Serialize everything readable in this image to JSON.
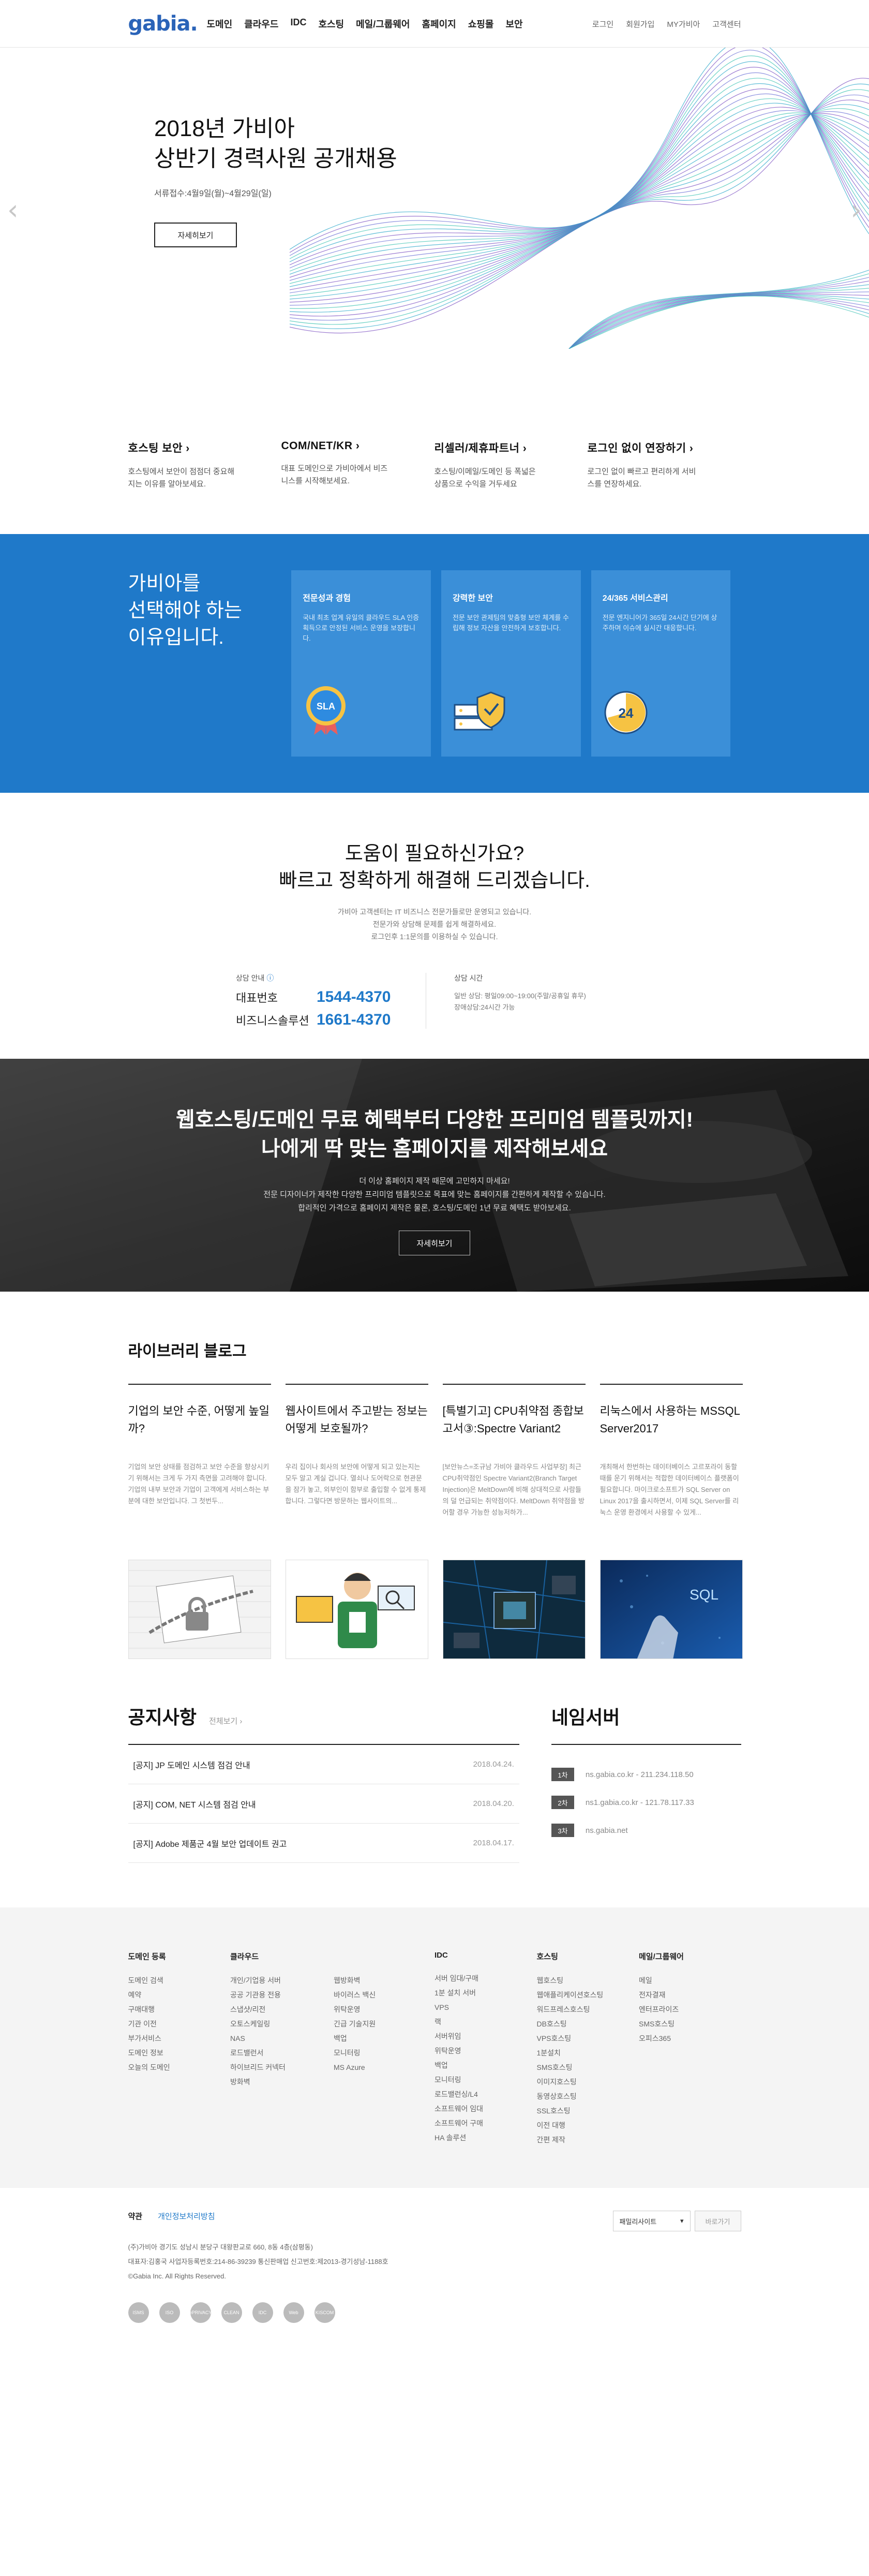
{
  "header": {
    "logo": "gabia.",
    "gnb": [
      "도메인",
      "클라우드",
      "IDC",
      "호스팅",
      "메일/그룹웨어",
      "홈페이지",
      "쇼핑몰",
      "보안"
    ],
    "util": [
      "로그인",
      "회원가입",
      "MY가비아",
      "고객센터"
    ]
  },
  "hero": {
    "title_line1": "2018년 가비아",
    "title_line2": "상반기 경력사원 공개채용",
    "period": "서류접수:4월9일(월)~4월29일(일)",
    "button": "자세히보기",
    "prev": "‹",
    "next": "›"
  },
  "services": [
    {
      "title": "호스팅 보안",
      "desc": "호스팅에서 보안이 점점더 중요해지는 이유를 알아보세요."
    },
    {
      "title": "COM/NET/KR",
      "desc": "대표 도메인으로 가비아에서 비즈니스를 시작해보세요."
    },
    {
      "title": "리셀러/제휴파트너",
      "desc": "호스팅/이메일/도메인 등 폭넓은 상품으로 수익을 거두세요"
    },
    {
      "title": "로그인 없이 연장하기",
      "desc": "로그인 없이 빠르고 편리하게 서비스를 연장하세요."
    }
  ],
  "why": {
    "title_line1": "가비아를",
    "title_line2": "선택해야 하는",
    "title_line3": "이유입니다.",
    "cards": [
      {
        "title": "전문성과 경험",
        "desc": "국내 최초 업계 유일의 클라우드 SLA 인증 획득으로 안정된 서비스 운영을 보장합니다.",
        "badge": "SLA"
      },
      {
        "title": "강력한 보안",
        "desc": "전문 보안 관제팀의 맞춤형 보안 체계를 수립해 정보 자산을 안전하게 보호합니다."
      },
      {
        "title": "24/365 서비스관리",
        "desc": "전문 엔지니어가 365일 24시간 단기에 상주하며 이슈에 실시간 대응합니다.",
        "badge": "24"
      }
    ]
  },
  "help": {
    "title_line1": "도움이 필요하신가요?",
    "title_line2": "빠르고 정확하게 해결해 드리겠습니다.",
    "sub_line1": "가비아 고객센터는 IT 비즈니스 전문가들로만 운영되고 있습니다.",
    "sub_line2": "전문가와 상담해 문제를 쉽게 해결하세요.",
    "sub_line3": "로그인후 1:1문의를 이용하실 수 있습니다.",
    "contact_title": "상담 안내",
    "rep_label": "대표번호",
    "rep_number": "1544-4370",
    "biz_label": "비즈니스솔루션",
    "biz_number": "1661-4370",
    "hours_title": "상담 시간",
    "hours_line1": "일반 상담: 평일09:00~19:00(주말/공휴일 휴무)",
    "hours_line2": "장애상담:24시간 가능"
  },
  "banner": {
    "title_line1": "웹호스팅/도메인 무료 혜택부터 다양한 프리미엄 템플릿까지!",
    "title_line2": "나에게 딱 맞는 홈페이지를 제작해보세요",
    "desc_line1": "더 이상 홈페이지 제작 때문에 고민하지 마세요!",
    "desc_line2": "전문 디자이너가 제작한 다양한 프리미엄 템플릿으로 목표에 맞는 홈페이지를 간편하게 제작할 수 있습니다.",
    "desc_line3": "합리적인 가격으로 홈페이지 제작은 물론, 호스팅/도메인 1년 무료 혜택도 받아보세요.",
    "button": "자세히보기"
  },
  "blog": {
    "title": "라이브러리 블로그",
    "posts": [
      {
        "title": "기업의 보안 수준, 어떻게 높일까?",
        "excerpt": "기업의 보안 상태를 점검하고 보안 수준을 향상시키기 위해서는 크게 두 가지 측면을 고려해야 합니다. 기업의 내부 보안과 기업이 고객에게 서비스하는 부분에 대한 보안입니다. 그 첫번두..."
      },
      {
        "title": "웹사이트에서 주고받는 정보는 어떻게 보호될까?",
        "excerpt": "우리 집이나 회사의 보안에 어떻게 되고 있는지는 모두 알고 계실 겁니다. 열쇠나 도어락으로 현관문을 잠가 놓고, 외부인이 함부로 출입할 수 없게 통제합니다. 그렇다면 방문하는 웹사이트의..."
      },
      {
        "title": "[특별기고] CPU취약점 종합보고서③:Spectre Variant2",
        "excerpt": "[보안뉴스=조규남 가비아 클라우드 사업부장] 최근 CPU취약점인 Spectre Variant2(Branch Target Injection)은 MeltDown에 비해 상대적으로 사람들의 덜 언급되는 취약점이다. MeltDown 취약점을 방어할 경우 가능한 성능저하가..."
      },
      {
        "title": "리눅스에서 사용하는 MSSQL Server2017",
        "excerpt": "개최해서 한번하는 데이터베이스 고르포라이 동할때를 운기 위해서는 적합한 데이터베이스 플랫폼이 필요합니다. 마이크로소프트가 SQL Server on Linux 2017을 출시하면서, 이제 SQL Server를 리눅스 운영 환경에서 사용할 수 있게..."
      }
    ]
  },
  "notice": {
    "title": "공지사항",
    "more": "전체보기 ›",
    "items": [
      {
        "title": "[공지] JP 도메인 시스템 점검 안내",
        "date": "2018.04.24."
      },
      {
        "title": "[공지] COM, NET 시스템 점검 안내",
        "date": "2018.04.20."
      },
      {
        "title": "[공지] Adobe 제품군 4월 보안 업데이트 권고",
        "date": "2018.04.17."
      }
    ]
  },
  "nameserver": {
    "title": "네임서버",
    "items": [
      {
        "num": "1차",
        "host": "ns.gabia.co.kr - 211.234.118.50"
      },
      {
        "num": "2차",
        "host": "ns1.gabia.co.kr - 121.78.117.33"
      },
      {
        "num": "3차",
        "host": "ns.gabia.net"
      }
    ]
  },
  "sitemap": [
    {
      "title": "도메인 등록",
      "items": [
        "도메인 검색",
        "예약",
        "구매대행",
        "기관 이전",
        "부가서비스",
        "도메인 정보",
        "오늘의 도메인"
      ]
    },
    {
      "title": "클라우드",
      "items": [
        "개인/기업용 서버",
        "공공 기관용 전용",
        "스냅샷/리전",
        "오토스케일링",
        "NAS",
        "로드밸런서",
        "하이브리드 커넥터",
        "방화벽"
      ],
      "items2": [
        "웹방화벽",
        "바이러스 백신",
        "위탁운영",
        "긴급 기술지원",
        "백업",
        "모니터링",
        "MS Azure"
      ]
    },
    {
      "title": "IDC",
      "items": [
        "서버 임대/구매",
        "1분 설치 서버",
        "VPS",
        "랙",
        "서버위임",
        "위탁운영",
        "백업",
        "모니터링",
        "로드밸런싱/L4",
        "소프트웨어 임대",
        "소프트웨어 구매",
        "HA 솔루션"
      ]
    },
    {
      "title": "호스팅",
      "items": [
        "웹호스팅",
        "웹애플리케이션호스팅",
        "워드프레스호스팅",
        "DB호스팅",
        "VPS호스팅",
        "1분설치",
        "SMS호스팅",
        "이미지호스팅",
        "동영상호스팅",
        "SSL호스팅",
        "이전 대행",
        "간편 제작"
      ]
    },
    {
      "title": "메일/그룹웨어",
      "items": [
        "메일",
        "전자결재",
        "엔터프라이즈",
        "SMS호스팅",
        "오피스365"
      ]
    }
  ],
  "footer": {
    "terms": "약관",
    "privacy": "개인정보처리방침",
    "family_site": "패밀리사이트",
    "go": "바로가기",
    "info_line1": "(주)가비아      경기도 성남시 분당구 대왕판교로 660, 8동 4층(삼평동)",
    "info_line2": "대표자:김홍국      사업자등록번호:214-86-39239      통신판매업 신고번호:제2013-경기성남-1188호",
    "copyright": "©Gabia Inc. All Rights Reserved.",
    "certs": [
      "ISMS",
      "ISO",
      "ePRIVACY",
      "CLEAN",
      "IDC",
      "Web",
      "KISCOM"
    ]
  },
  "colors": {
    "brand": "#1f79c9",
    "logo": "#2a63b8"
  }
}
